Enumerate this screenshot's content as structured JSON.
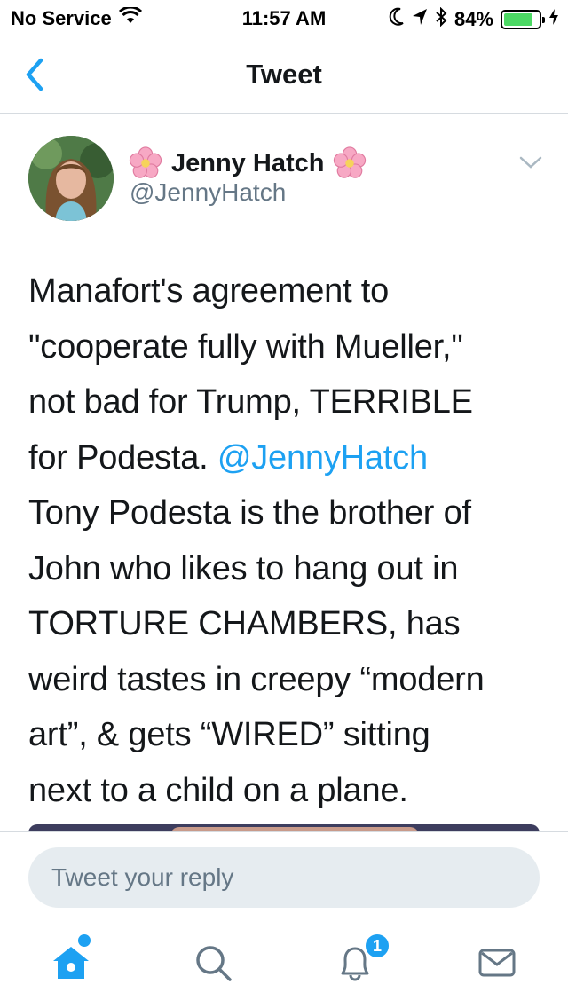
{
  "status_bar": {
    "carrier": "No Service",
    "time": "11:57 AM",
    "battery_percent": "84%",
    "battery_level": 0.84,
    "icons": [
      "wifi-icon",
      "moon-icon",
      "location-arrow-icon",
      "bluetooth-icon",
      "battery-icon",
      "charging-bolt-icon"
    ]
  },
  "nav": {
    "title": "Tweet",
    "back_icon": "chevron-left-icon"
  },
  "tweet": {
    "display_name": "Jenny Hatch",
    "handle": "@JennyHatch",
    "name_emoji": "cherry-blossom-icon",
    "text_before_mention": "Manafort's agreement to\n\"cooperate fully with Mueller,\"\nnot bad for Trump, TERRIBLE\nfor Podesta. ",
    "mention": "@JennyHatch",
    "text_after_mention": "\nTony Podesta  is the brother of\nJohn who likes to hang out in\nTORTURE CHAMBERS, has\nweird tastes in creepy “modern\nart”, & gets “WIRED” sitting\nnext to a child on a plane."
  },
  "reply": {
    "placeholder": "Tweet your reply"
  },
  "tabs": {
    "home": "home-icon",
    "search": "search-icon",
    "notifications": "bell-icon",
    "messages": "envelope-icon",
    "notification_count": "1"
  },
  "colors": {
    "accent": "#1da1f2",
    "text": "#14171a",
    "secondary": "#657786",
    "divider": "#d6dbe0",
    "battery": "#4cd964"
  }
}
